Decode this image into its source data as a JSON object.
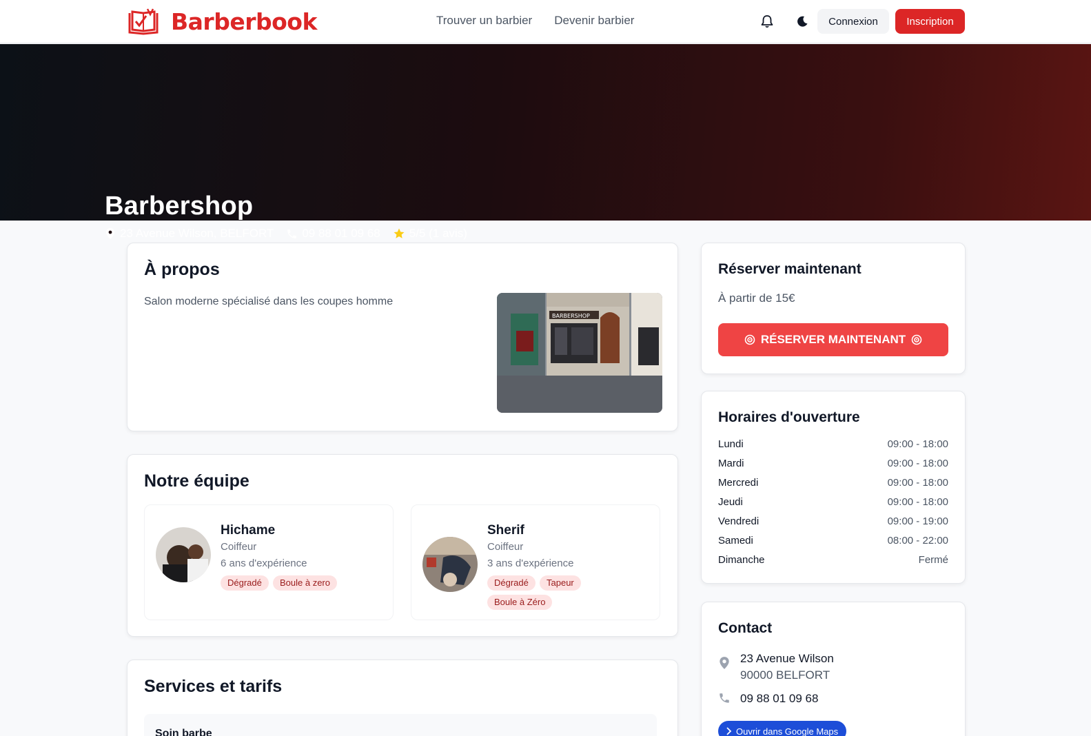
{
  "header": {
    "brand": "Barberbook",
    "nav": [
      "Trouver un barbier",
      "Devenir barbier"
    ],
    "login_label": "Connexion",
    "signup_label": "Inscription",
    "icons": [
      "bell-icon",
      "moon-icon"
    ]
  },
  "hero": {
    "title": "Barbershop",
    "address": "23 Avenue Wilson, BELFORT",
    "phone": "09 88 01 09 68",
    "rating": "5/5 (1 avis)"
  },
  "about": {
    "title": "À propos",
    "description": "Salon moderne spécialisé dans les coupes homme",
    "photo_sign": "BARBERSHOP"
  },
  "team": {
    "title": "Notre équipe",
    "members": [
      {
        "name": "Hichame",
        "role": "Coiffeur",
        "experience": "6 ans d'expérience",
        "tags": [
          "Dégradé",
          "Boule à zero"
        ]
      },
      {
        "name": "Sherif",
        "role": "Coiffeur",
        "experience": "3 ans d'expérience",
        "tags": [
          "Dégradé",
          "Tapeur",
          "Boule à Zéro"
        ]
      }
    ]
  },
  "services": {
    "title": "Services et tarifs",
    "items": [
      {
        "name": "Soin barbe"
      }
    ]
  },
  "booking": {
    "title": "Réserver maintenant",
    "price_from": "À partir de 15€",
    "button_label": "RÉSERVER MAINTENANT"
  },
  "hours": {
    "title": "Horaires d'ouverture",
    "days": [
      {
        "day": "Lundi",
        "time": "09:00 - 18:00"
      },
      {
        "day": "Mardi",
        "time": "09:00 - 18:00"
      },
      {
        "day": "Mercredi",
        "time": "09:00 - 18:00"
      },
      {
        "day": "Jeudi",
        "time": "09:00 - 18:00"
      },
      {
        "day": "Vendredi",
        "time": "09:00 - 19:00"
      },
      {
        "day": "Samedi",
        "time": "08:00 - 22:00"
      },
      {
        "day": "Dimanche",
        "time": "Fermé"
      }
    ]
  },
  "contact": {
    "title": "Contact",
    "address_line1": "23 Avenue Wilson",
    "address_line2": "90000 BELFORT",
    "phone": "09 88 01 09 68",
    "maps_label": "Ouvrir dans Google Maps"
  },
  "colors": {
    "brand": "#dc2626",
    "book_button": "#ef4444",
    "maps_button": "#1d4ed8",
    "tag_bg": "#fde2e2"
  }
}
